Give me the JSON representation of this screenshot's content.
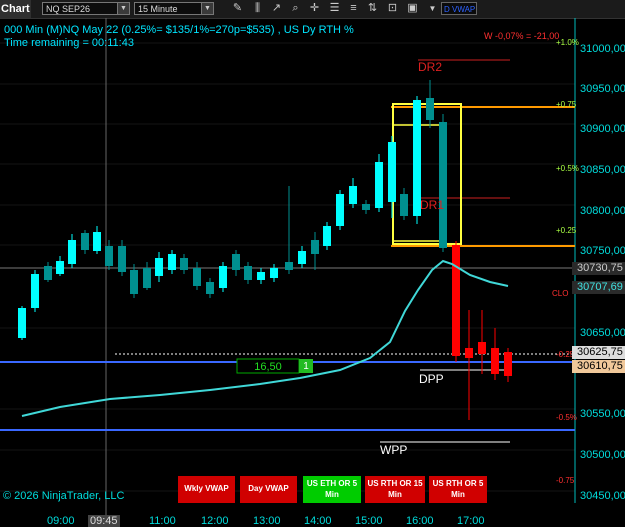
{
  "toolbar": {
    "title": "Chart",
    "instrument": "NQ SEP26",
    "interval": "15 Minute",
    "icons": [
      "pencil-icon",
      "bars-icon",
      "ruler-icon",
      "zoom-icon",
      "crosshair-icon",
      "properties-icon",
      "list-icon",
      "sort-icon",
      "chart-style-icon",
      "screenshot-icon"
    ],
    "vwap_selector": "D VWAP"
  },
  "header": {
    "line1": "000 Min (M)NQ May 22 (0.25%= $135/1%=270p=$535) , US Dy RTH %",
    "line2": "Time remaining = 00:11:43",
    "win_loss": "W -0,07% = -21,00"
  },
  "levels": {
    "dr2": "DR2",
    "dr1": "DR1",
    "dpp": "DPP",
    "wpp": "WPP"
  },
  "percent_labels": [
    "+1.0%",
    "+0.75",
    "+0.5%",
    "+0.25",
    "CLO",
    "-0.25",
    "-0.5%",
    "-0.75"
  ],
  "y_axis": [
    "31000,00",
    "30950,00",
    "30900,00",
    "30850,00",
    "30800,00",
    "30750,00",
    "30650,00",
    "30550,00",
    "30500,00",
    "30450,00"
  ],
  "price_tags": {
    "t1": "30730,75",
    "t2": "30707,69",
    "t3": "30625,75",
    "t4": "30610,75"
  },
  "x_axis": [
    "09:00",
    "09:45",
    "11:00",
    "12:00",
    "13:00",
    "14:00",
    "15:00",
    "16:00",
    "17:00"
  ],
  "order_box": {
    "value": "16,50",
    "qty": "1"
  },
  "copyright": "© 2026 NinjaTrader, LLC",
  "buttons": {
    "wkly": "Wkly VWAP",
    "day": "Day VWAP",
    "eth": "US ETH OR 5 Min",
    "rth15": "US RTH OR 15 Min",
    "rth5": "US RTH OR 5 Min"
  },
  "colors": {
    "up": "#00ffff",
    "down": "#009090",
    "bear": "#ff0000",
    "axis": "#00dddd",
    "vwap": "#2a55c8",
    "orange": "#ff9a00",
    "yellow": "#ffff40",
    "button_red": "#d00000",
    "button_green": "#00cc00"
  }
}
